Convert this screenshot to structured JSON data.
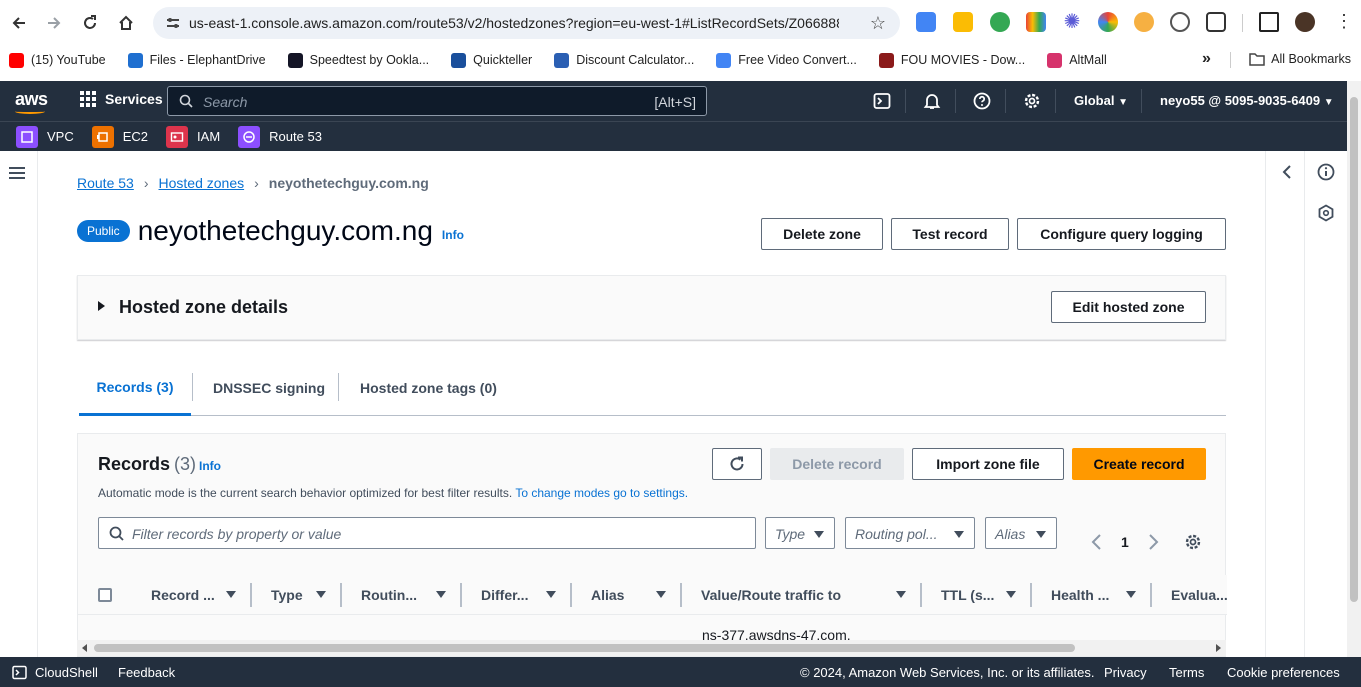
{
  "browser": {
    "url": "us-east-1.console.aws.amazon.com/route53/v2/hostedzones?region=eu-west-1#ListRecordSets/Z0668885...",
    "bookmarks": [
      {
        "label": "(15) YouTube",
        "color": "#ff0000"
      },
      {
        "label": "Files - ElephantDrive",
        "color": "#1f6fd0"
      },
      {
        "label": "Speedtest by Ookla...",
        "color": "#141526"
      },
      {
        "label": "Quickteller",
        "color": "#1a4f9c"
      },
      {
        "label": "Discount Calculator...",
        "color": "#2b5fb3"
      },
      {
        "label": "Free Video Convert...",
        "color": "#4285f4"
      },
      {
        "label": "FOU MOVIES - Dow...",
        "color": "#8b1a1a"
      },
      {
        "label": "AltMall",
        "color": "#d6336c"
      }
    ],
    "overflow_label": "»",
    "all_bookmarks": "All Bookmarks"
  },
  "aws": {
    "logo": "aws",
    "services_label": "Services",
    "search_placeholder": "Search",
    "search_shortcut": "[Alt+S]",
    "region": "Global",
    "account": "neyo55 @ 5095-9035-6409",
    "favorites": [
      {
        "label": "VPC",
        "color": "#8c4fff"
      },
      {
        "label": "EC2",
        "color": "#ed7100"
      },
      {
        "label": "IAM",
        "color": "#dd344c"
      },
      {
        "label": "Route 53",
        "color": "#8c4fff"
      }
    ]
  },
  "breadcrumb": {
    "items": [
      "Route 53",
      "Hosted zones"
    ],
    "current": "neyothetechguy.com.ng"
  },
  "header": {
    "badge": "Public",
    "title": "neyothetechguy.com.ng",
    "info": "Info",
    "buttons": {
      "delete_zone": "Delete zone",
      "test_record": "Test record",
      "configure_logging": "Configure query logging"
    }
  },
  "zone_details": {
    "title": "Hosted zone details",
    "edit_button": "Edit hosted zone"
  },
  "tabs": [
    {
      "label": "Records (3)",
      "active": true
    },
    {
      "label": "DNSSEC signing",
      "active": false
    },
    {
      "label": "Hosted zone tags (0)",
      "active": false
    }
  ],
  "records": {
    "title": "Records",
    "count": "(3)",
    "info": "Info",
    "description": "Automatic mode is the current search behavior optimized for best filter results.",
    "description_link": "To change modes go to settings.",
    "buttons": {
      "delete_record": "Delete record",
      "import_zone": "Import zone file",
      "create_record": "Create record"
    },
    "filter_placeholder": "Filter records by property or value",
    "dropdowns": {
      "type": "Type",
      "routing": "Routing pol...",
      "alias": "Alias"
    },
    "page": "1",
    "columns": [
      "Record ...",
      "Type",
      "Routin...",
      "Differ...",
      "Alias",
      "Value/Route traffic to",
      "TTL (s...",
      "Health ...",
      "Evalua..."
    ],
    "first_row_value": "ns-377.awsdns-47.com."
  },
  "footer": {
    "cloudshell": "CloudShell",
    "feedback": "Feedback",
    "copyright": "© 2024, Amazon Web Services, Inc. or its affiliates.",
    "privacy": "Privacy",
    "terms": "Terms",
    "cookies": "Cookie preferences"
  },
  "colors": {
    "aws_nav": "#232f3e",
    "link_blue": "#0972d3",
    "primary_orange": "#ff9900"
  }
}
